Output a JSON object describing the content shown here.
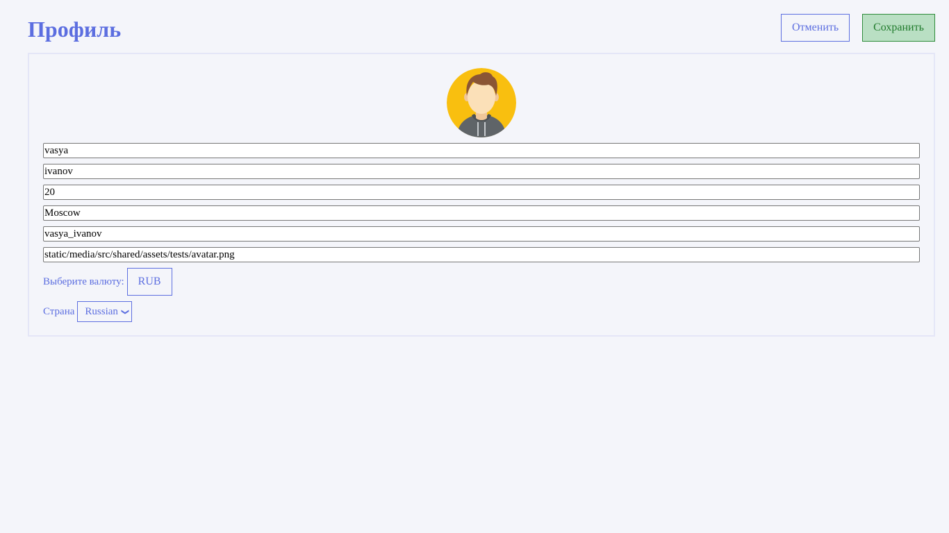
{
  "header": {
    "title": "Профиль",
    "cancel_label": "Отменить",
    "save_label": "Сохранить"
  },
  "profile": {
    "avatar_icon": "user-avatar-icon",
    "fields": {
      "first_name": "vasya",
      "last_name": "ivanov",
      "age": "20",
      "city": "Moscow",
      "username": "vasya_ivanov",
      "avatar": "static/media/src/shared/assets/tests/avatar.png"
    },
    "currency": {
      "label": "Выберите валюту:",
      "value": "RUB"
    },
    "country": {
      "label": "Страна",
      "value": "Russian"
    }
  },
  "colors": {
    "background": "#f4f5fa",
    "accent": "#5c6ee0",
    "save_bg": "#b9dfc3",
    "save_text": "#1f7a2b",
    "avatar_bg": "#f9bf0f"
  }
}
